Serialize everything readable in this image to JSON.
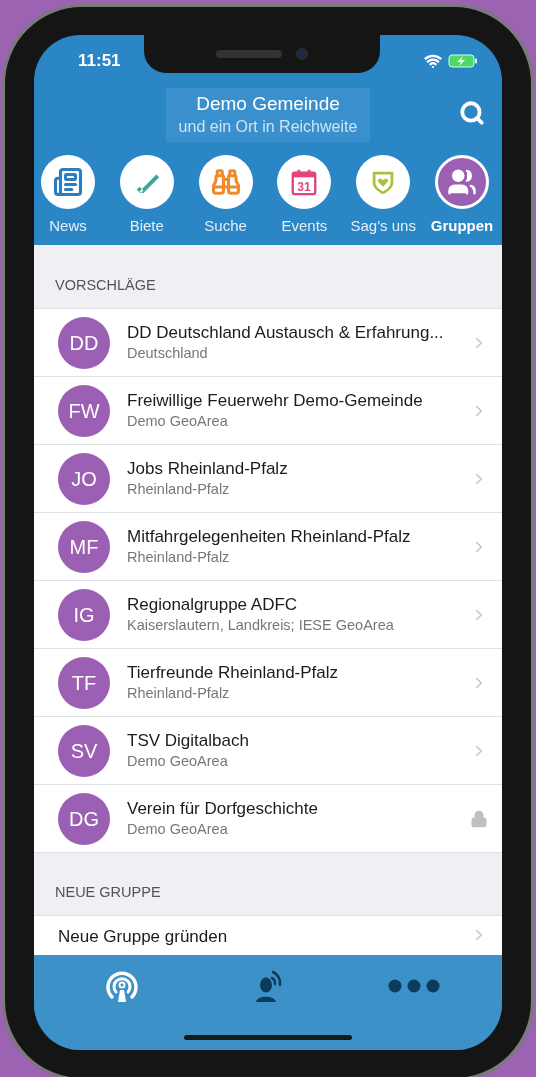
{
  "status_bar": {
    "time": "11:51"
  },
  "header": {
    "title": "Demo Gemeinde",
    "subtitle": "und ein Ort in Reichweite"
  },
  "categories": [
    {
      "label": "News",
      "selected": false
    },
    {
      "label": "Biete",
      "selected": false
    },
    {
      "label": "Suche",
      "selected": false
    },
    {
      "label": "Events",
      "selected": false,
      "icon_text": "31"
    },
    {
      "label": "Sag's uns",
      "selected": false
    },
    {
      "label": "Gruppen",
      "selected": true
    }
  ],
  "sections": [
    {
      "title": "VORSCHLÄGE",
      "rows": [
        {
          "initials": "DD",
          "title": "DD Deutschland Austausch & Erfahrung...",
          "subtitle": "Deutschland",
          "locked": false
        },
        {
          "initials": "FW",
          "title": "Freiwillige Feuerwehr Demo-Gemeinde",
          "subtitle": "Demo GeoArea",
          "locked": false
        },
        {
          "initials": "JO",
          "title": "Jobs Rheinland-Pfalz",
          "subtitle": "Rheinland-Pfalz",
          "locked": false
        },
        {
          "initials": "MF",
          "title": "Mitfahrgelegenheiten Rheinland-Pfalz",
          "subtitle": "Rheinland-Pfalz",
          "locked": false
        },
        {
          "initials": "IG",
          "title": "Regionalgruppe ADFC",
          "subtitle": "Kaiserslautern, Landkreis; IESE GeoArea",
          "locked": false
        },
        {
          "initials": "TF",
          "title": "Tierfreunde Rheinland-Pfalz",
          "subtitle": "Rheinland-Pfalz",
          "locked": false
        },
        {
          "initials": "SV",
          "title": "TSV Digitalbach",
          "subtitle": "Demo GeoArea",
          "locked": false
        },
        {
          "initials": "DG",
          "title": "Verein für Dorfgeschichte",
          "subtitle": "Demo GeoArea",
          "locked": true
        }
      ]
    },
    {
      "title": "NEUE GRUPPE",
      "rows": [
        {
          "title": "Neue Gruppe gründen",
          "locked": false
        }
      ]
    }
  ],
  "tab_bar": [
    {
      "selected": true
    },
    {
      "selected": false
    },
    {
      "selected": false
    }
  ]
}
